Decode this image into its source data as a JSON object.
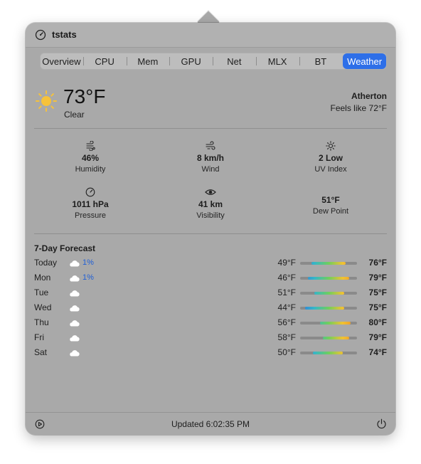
{
  "app": {
    "title": "tstats"
  },
  "tabs": [
    {
      "label": "Overview"
    },
    {
      "label": "CPU"
    },
    {
      "label": "Mem"
    },
    {
      "label": "GPU"
    },
    {
      "label": "Net"
    },
    {
      "label": "MLX"
    },
    {
      "label": "BT"
    },
    {
      "label": "Weather",
      "active": true
    }
  ],
  "current": {
    "temperature": "73°F",
    "condition": "Clear",
    "location": "Atherton",
    "feels_like": "Feels like 72°F",
    "icon": "sun-icon"
  },
  "metrics": [
    {
      "icon": "humidity-icon",
      "value": "46%",
      "label": "Humidity"
    },
    {
      "icon": "wind-icon",
      "value": "8 km/h",
      "label": "Wind"
    },
    {
      "icon": "uv-sun-icon",
      "value": "2 Low",
      "label": "UV Index"
    },
    {
      "icon": "gauge-icon",
      "value": "1011 hPa",
      "label": "Pressure"
    },
    {
      "icon": "eye-icon",
      "value": "41 km",
      "label": "Visibility"
    },
    {
      "icon": "",
      "value": "51°F",
      "label": "Dew Point"
    }
  ],
  "forecast": {
    "title": "7-Day Forecast",
    "range_min": 40,
    "range_max": 85,
    "days": [
      {
        "day": "Today",
        "precip": "1%",
        "low_label": "49°F",
        "high_label": "76°F",
        "low": 49,
        "high": 76
      },
      {
        "day": "Mon",
        "precip": "1%",
        "low_label": "46°F",
        "high_label": "79°F",
        "low": 46,
        "high": 79
      },
      {
        "day": "Tue",
        "precip": "",
        "low_label": "51°F",
        "high_label": "75°F",
        "low": 51,
        "high": 75
      },
      {
        "day": "Wed",
        "precip": "",
        "low_label": "44°F",
        "high_label": "75°F",
        "low": 44,
        "high": 75
      },
      {
        "day": "Thu",
        "precip": "",
        "low_label": "56°F",
        "high_label": "80°F",
        "low": 56,
        "high": 80
      },
      {
        "day": "Fri",
        "precip": "",
        "low_label": "58°F",
        "high_label": "79°F",
        "low": 58,
        "high": 79
      },
      {
        "day": "Sat",
        "precip": "",
        "low_label": "50°F",
        "high_label": "74°F",
        "low": 50,
        "high": 74
      }
    ]
  },
  "footer": {
    "updated": "Updated 6:02:35 PM"
  },
  "colors": {
    "accent": "#2e6fe8",
    "precip": "#1f5fd6",
    "sun": "#f6c23a"
  }
}
